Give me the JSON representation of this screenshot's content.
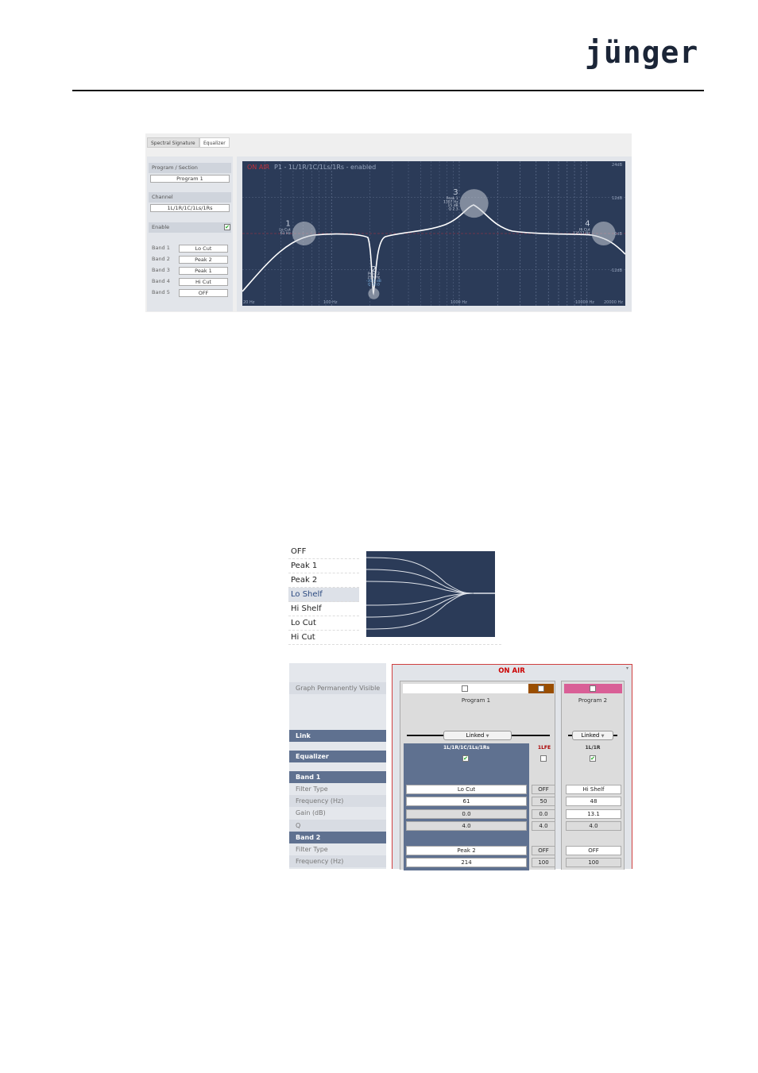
{
  "header": {
    "logo": "jünger"
  },
  "eq_window": {
    "tabs": [
      "Spectral Signature",
      "Equalizer"
    ],
    "program_section_label": "Program / Section",
    "program_value": "Program 1",
    "channel_label": "Channel",
    "channel_value": "1L/1R/1C/1Ls/1Rs",
    "enable_label": "Enable",
    "enabled": true,
    "bands": [
      {
        "label": "Band 1",
        "value": "Lo Cut"
      },
      {
        "label": "Band 2",
        "value": "Peak 2"
      },
      {
        "label": "Band 3",
        "value": "Peak 1"
      },
      {
        "label": "Band 4",
        "value": "Hi Cut"
      },
      {
        "label": "Band 5",
        "value": "OFF"
      }
    ],
    "graph": {
      "on_air": "ON AIR",
      "title": "P1 - 1L/1R/1C/1Ls/1Rs - enabled",
      "y_labels": [
        "24dB",
        "12dB",
        "0dB",
        "-12dB"
      ],
      "x_labels": [
        "20 Hz",
        "100 Hz",
        "1000 Hz",
        "10000 Hz",
        "20000 Hz"
      ],
      "handles": [
        {
          "num": "1",
          "lines": [
            "Lo Cut",
            "61 Hz"
          ],
          "freq": 61,
          "gain": 0
        },
        {
          "num": "2",
          "lines": [
            "Peak 2",
            "214 Hz",
            "-30.0 dB",
            "Q 10.0"
          ],
          "freq": 214,
          "gain": -20
        },
        {
          "num": "3",
          "lines": [
            "Peak 1",
            "1307 Hz",
            "15 dB",
            "Q 2.3"
          ],
          "freq": 1307,
          "gain": 10
        },
        {
          "num": "4",
          "lines": [
            "Hi Cut",
            "13517 Hz"
          ],
          "freq": 13517,
          "gain": 0
        }
      ],
      "colors": {
        "background": "#2b3b58",
        "on_air": "#c0303a",
        "curve": "#ffffff"
      }
    }
  },
  "filter_types": {
    "options": [
      "OFF",
      "Peak 1",
      "Peak 2",
      "Lo Shelf",
      "Hi Shelf",
      "Lo Cut",
      "Hi Cut"
    ],
    "selected": "Lo Shelf"
  },
  "settings_table": {
    "on_air": "ON AIR",
    "rows": {
      "graph": "Graph Permanently Visible",
      "link": "Link",
      "equalizer": "Equalizer",
      "band1": "Band 1",
      "filter_type": "Filter Type",
      "frequency": "Frequency (Hz)",
      "gain": "Gain (dB)",
      "q": "Q",
      "band2": "Band 2"
    },
    "programs": [
      {
        "name": "Program 1",
        "link": "Linked",
        "color": "#9a4e00"
      },
      {
        "name": "Program 2",
        "link": "Linked",
        "color": "#d95f96"
      }
    ],
    "channels": [
      {
        "name": "1L/1R/1C/1Ls/1Rs",
        "checked": true,
        "b1": [
          "Lo Cut",
          "61",
          "0.0",
          "4.0"
        ],
        "b2": [
          "Peak 2",
          "214"
        ]
      },
      {
        "name": "1LFE",
        "checked": false,
        "b1": [
          "OFF",
          "50",
          "0.0",
          "4.0"
        ],
        "b2": [
          "OFF",
          "100"
        ]
      },
      {
        "name": "1L/1R",
        "checked": true,
        "b1": [
          "Hi Shelf",
          "48",
          "13.1",
          "4.0"
        ],
        "b2": [
          "OFF",
          "100"
        ]
      }
    ]
  }
}
